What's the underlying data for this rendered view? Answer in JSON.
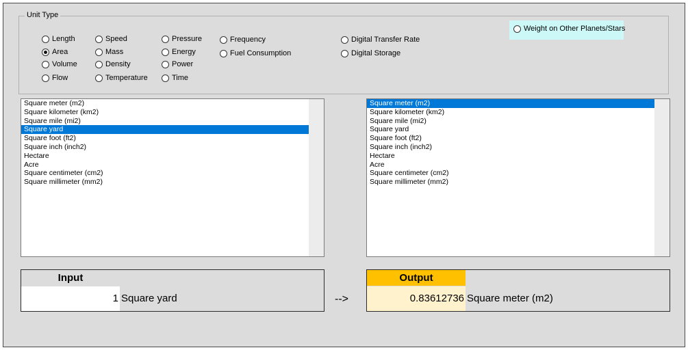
{
  "unit_type": {
    "label": "Unit Type",
    "options": [
      {
        "label": "Length",
        "checked": false
      },
      {
        "label": "Area",
        "checked": true
      },
      {
        "label": "Volume",
        "checked": false
      },
      {
        "label": "Flow",
        "checked": false
      },
      {
        "label": "Speed",
        "checked": false
      },
      {
        "label": "Mass",
        "checked": false
      },
      {
        "label": "Density",
        "checked": false
      },
      {
        "label": "Temperature",
        "checked": false
      },
      {
        "label": "Pressure",
        "checked": false
      },
      {
        "label": "Energy",
        "checked": false
      },
      {
        "label": "Power",
        "checked": false
      },
      {
        "label": "Time",
        "checked": false
      },
      {
        "label": "Frequency",
        "checked": false
      },
      {
        "label": "Fuel Consumption",
        "checked": false
      },
      {
        "label": "Digital Transfer Rate",
        "checked": false
      },
      {
        "label": "Digital Storage",
        "checked": false
      },
      {
        "label": "Weight on Other Planets/Stars",
        "checked": false
      }
    ]
  },
  "from_list": {
    "selected": "Square yard",
    "items": [
      "Square meter (m2)",
      "Square kilometer (km2)",
      "Square mile (mi2)",
      "Square yard",
      "Square foot (ft2)",
      "Square inch (inch2)",
      "Hectare",
      "Acre",
      "Square centimeter (cm2)",
      "Square millimeter (mm2)"
    ]
  },
  "to_list": {
    "selected": "Square meter (m2)",
    "items": [
      "Square meter (m2)",
      "Square kilometer (km2)",
      "Square mile (mi2)",
      "Square yard",
      "Square foot (ft2)",
      "Square inch (inch2)",
      "Hectare",
      "Acre",
      "Square centimeter (cm2)",
      "Square millimeter (mm2)"
    ]
  },
  "input": {
    "header": "Input",
    "value": "1",
    "unit": "Square yard"
  },
  "arrow": "-->",
  "output": {
    "header": "Output",
    "value": "0.83612736",
    "unit": "Square meter (m2)"
  },
  "colors": {
    "selection": "#0078d7",
    "output_header": "#ffc000",
    "output_value_bg": "#fff2cc",
    "weight_highlight": "#ccf8f8"
  }
}
